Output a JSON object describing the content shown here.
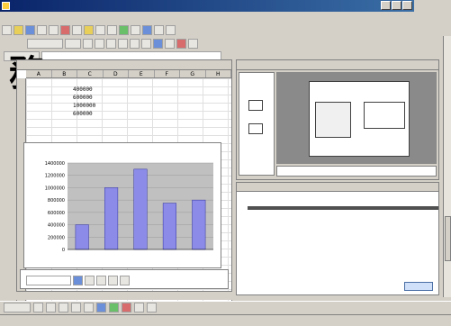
{
  "window": {
    "title": ""
  },
  "menu": {
    "items": [
      "",
      "",
      "",
      "",
      "",
      "",
      "",
      "",
      "",
      ""
    ]
  },
  "overlay_glyph": "務",
  "spreadsheet": {
    "pane_title": "",
    "columns": [
      "A",
      "B",
      "C",
      "D",
      "E",
      "F",
      "G",
      "H"
    ],
    "cells": {
      "values": [
        "400000",
        "600000",
        "1000000",
        "600000"
      ]
    },
    "sheet_tabs": ""
  },
  "chart_data": {
    "type": "bar",
    "title": "",
    "categories": [
      "",
      "",
      "",
      "",
      ""
    ],
    "series": [
      {
        "values": [
          400000,
          1000000,
          1300000,
          750000,
          800000
        ]
      }
    ],
    "ylim": [
      0,
      1400000
    ],
    "yticks": [
      "1400000",
      "1200000",
      "1000000",
      "800000",
      "600000",
      "400000",
      "200000",
      "0"
    ],
    "bar_color": "#8c8ce8",
    "grid": true
  },
  "slide_pane": {
    "title": "",
    "footer": "",
    "slide_title": ""
  },
  "notes_pane": {
    "title": "",
    "text": ""
  },
  "status": {
    "text": ""
  },
  "colors": {
    "titlebar": "#0a246a",
    "accent": "#3a6ea5",
    "bar": "#8c8ce8"
  }
}
